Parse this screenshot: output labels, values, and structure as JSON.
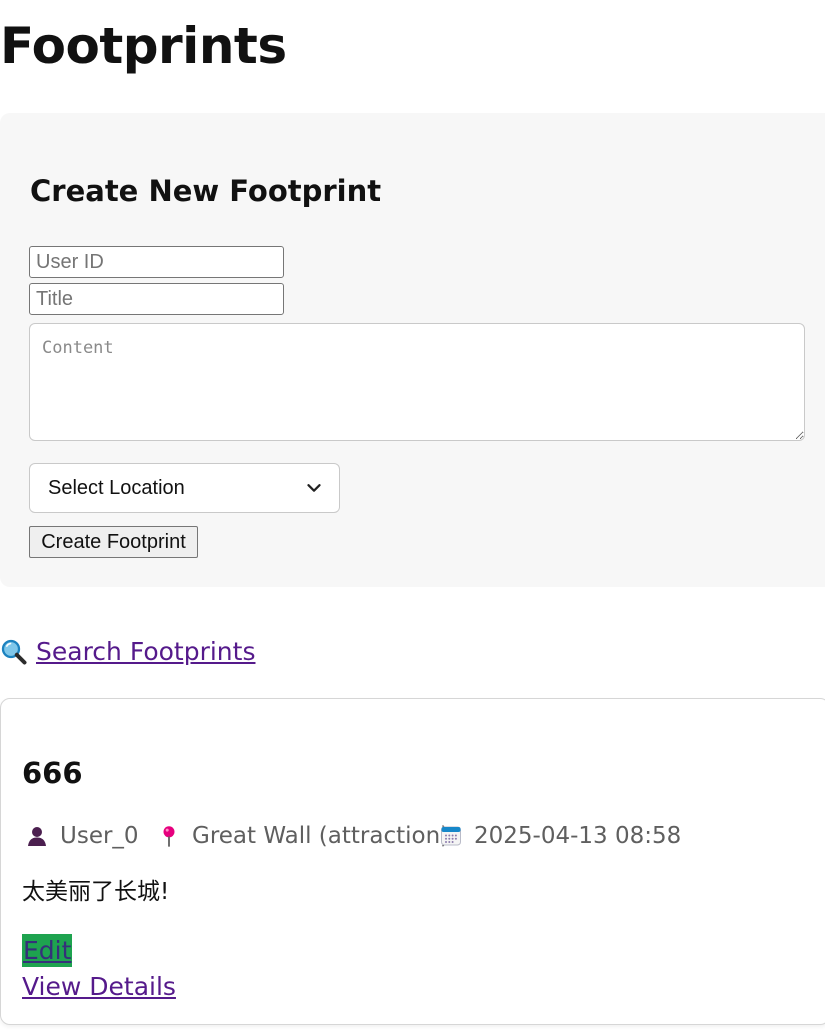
{
  "page": {
    "title": "Footprints"
  },
  "create_form": {
    "title": "Create New Footprint",
    "user_id_placeholder": "User ID",
    "title_placeholder": "Title",
    "content_placeholder": "Content",
    "location_select_value": "Select Location",
    "create_button_label": "Create Footprint"
  },
  "search": {
    "label": "Search Footprints",
    "icon": "search-icon"
  },
  "footprints": [
    {
      "title": "666",
      "user": "User_0",
      "location": "Great Wall (attraction)",
      "date": "2025-04-13 08:58",
      "content": "太美丽了长城!",
      "edit_label": "Edit",
      "details_label": "View Details",
      "icons": {
        "user": "user-icon",
        "location": "location-pin-icon",
        "date": "calendar-icon"
      }
    }
  ],
  "colors": {
    "panel_background": "#f7f7f7",
    "link_visited": "#551a8b",
    "edit_background": "#1ea34f",
    "location_pin": "#e6007e",
    "calendar_accent": "#1687c9"
  }
}
